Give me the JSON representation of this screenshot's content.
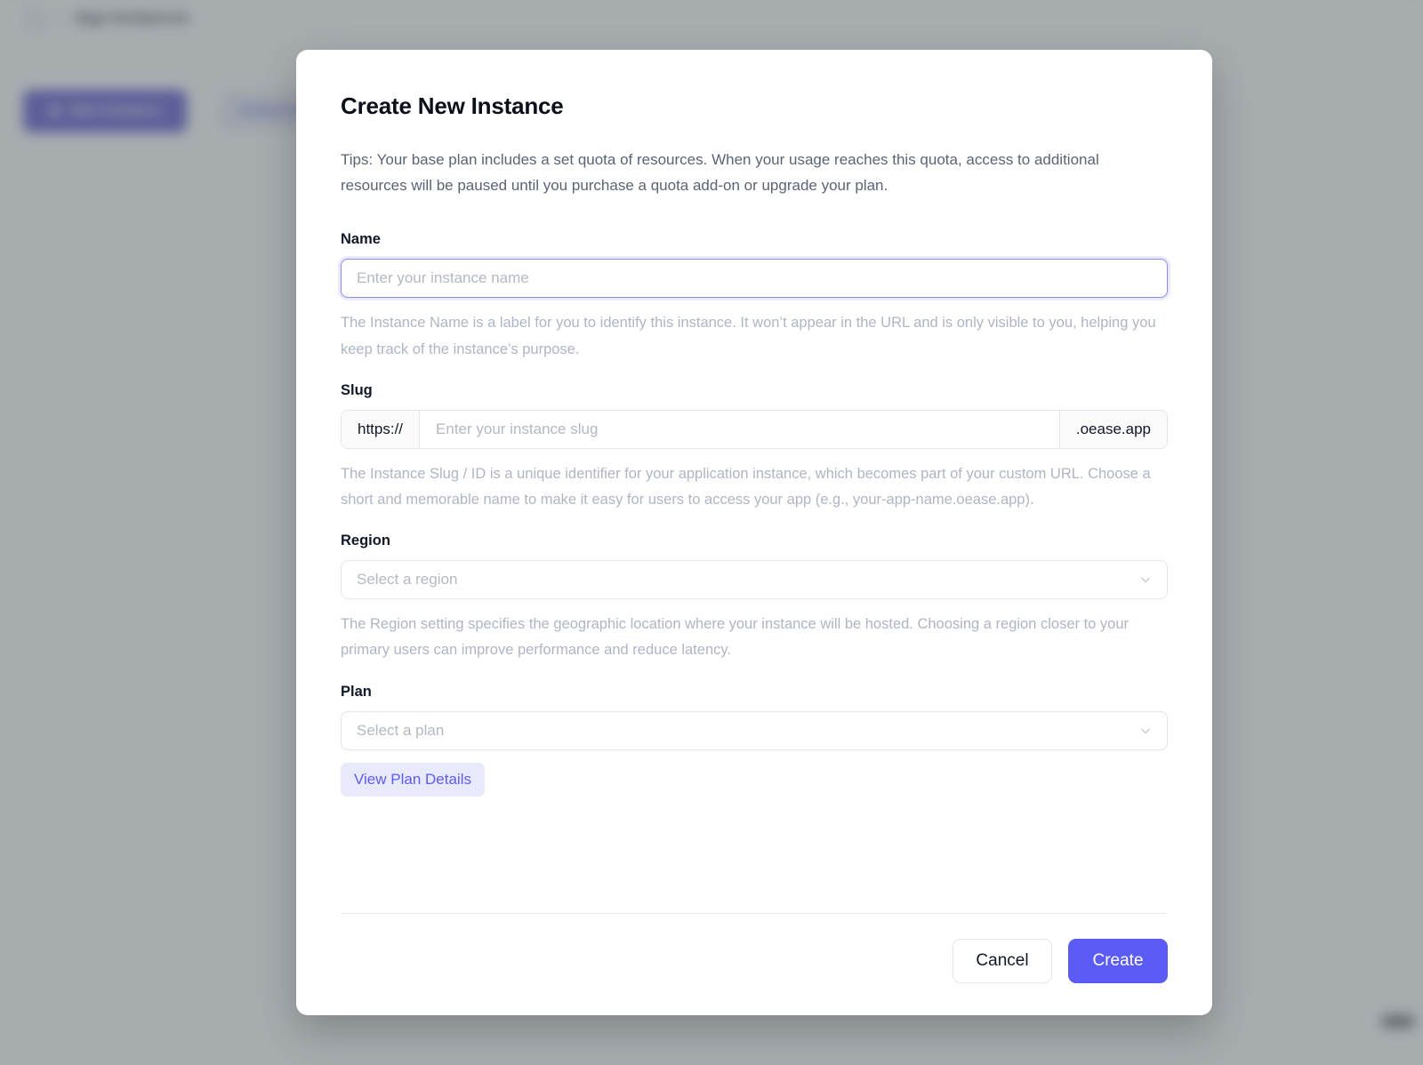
{
  "background": {
    "breadcrumb": {
      "home_icon": "home-icon",
      "separator": "/",
      "current": "App Instances"
    },
    "new_instance_button": {
      "icon": "plus-icon",
      "label": "New Instance"
    },
    "tab_chip": "Instances"
  },
  "modal": {
    "title": "Create New Instance",
    "tips": "Tips: Your base plan includes a set quota of resources. When your usage reaches this quota, access to additional resources will be paused until you purchase a quota add-on or upgrade your plan.",
    "fields": {
      "name": {
        "label": "Name",
        "value": "",
        "placeholder": "Enter your instance name",
        "help": "The Instance Name is a label for you to identify this instance. It won’t appear in the URL and is only visible to you, helping you keep track of the instance’s purpose.",
        "focused": true
      },
      "slug": {
        "label": "Slug",
        "prefix": "https://",
        "suffix": ".oease.app",
        "value": "",
        "placeholder": "Enter your instance slug",
        "help": "The Instance Slug / ID is a unique identifier for your application instance, which becomes part of your custom URL. Choose a short and memorable name to make it easy for users to access your app (e.g., your-app-name.oease.app)."
      },
      "region": {
        "label": "Region",
        "selected": "Select a region",
        "chevron_icon": "chevron-down-icon",
        "help": "The Region setting specifies the geographic location where your instance will be hosted. Choosing a region closer to your primary users can improve performance and reduce latency."
      },
      "plan": {
        "label": "Plan",
        "selected": "Select a plan",
        "chevron_icon": "chevron-down-icon",
        "details_button": "View Plan Details"
      }
    },
    "footer": {
      "cancel_label": "Cancel",
      "create_label": "Create"
    }
  },
  "colors": {
    "accent": "#5b5bf5",
    "accent_soft_bg": "#e8e9fb",
    "background_button": "#3c34c4",
    "scrim": "#71797e",
    "help_text": "#aeb5c4",
    "tips_text": "#5a6475"
  }
}
